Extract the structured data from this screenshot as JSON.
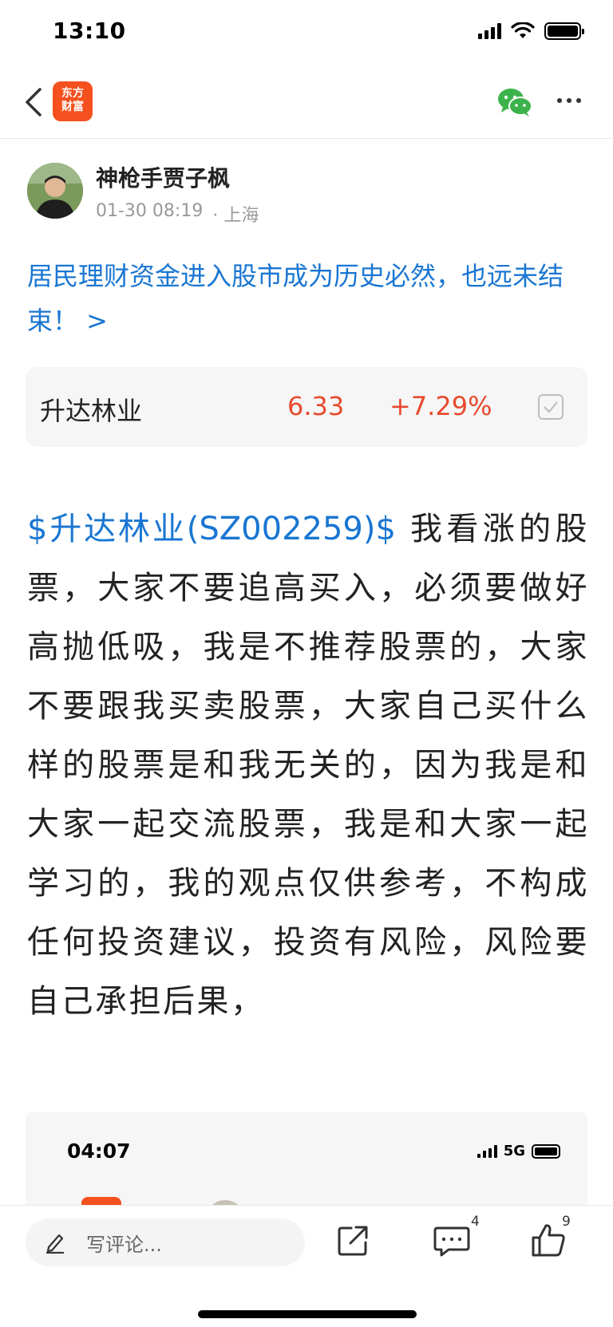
{
  "status_bar": {
    "time": "13:10"
  },
  "nav": {
    "logo_line1": "东方",
    "logo_line2": "财富",
    "brand_color": "#f4511e"
  },
  "author": {
    "name": "神枪手贾子枫",
    "date": "01-30 08:19",
    "location": "· 上海"
  },
  "headline": "居民理财资金进入股市成为历史必然，也远未结束！ >",
  "stock": {
    "name": "升达林业",
    "price": "6.33",
    "change": "+7.29%",
    "up_color": "#e84a2f"
  },
  "post": {
    "stock_link": "$升达林业(SZ002259)$",
    "body": " 我看涨的股票，大家不要追高买入，必须要做好高抛低吸，我是不推荐股票的，大家不要跟我买卖股票，大家自己买什么样的股票是和我无关的，因为我是和大家一起交流股票，我是和大家一起学习的，我的观点仅供参考，不构成任何投资建议，投资有风险，风险要自己承担后果，"
  },
  "embedded_image": {
    "time": "04:07",
    "network": "5G"
  },
  "bottom_bar": {
    "comment_placeholder": "写评论...",
    "comment_count": "4",
    "like_count": "9"
  }
}
